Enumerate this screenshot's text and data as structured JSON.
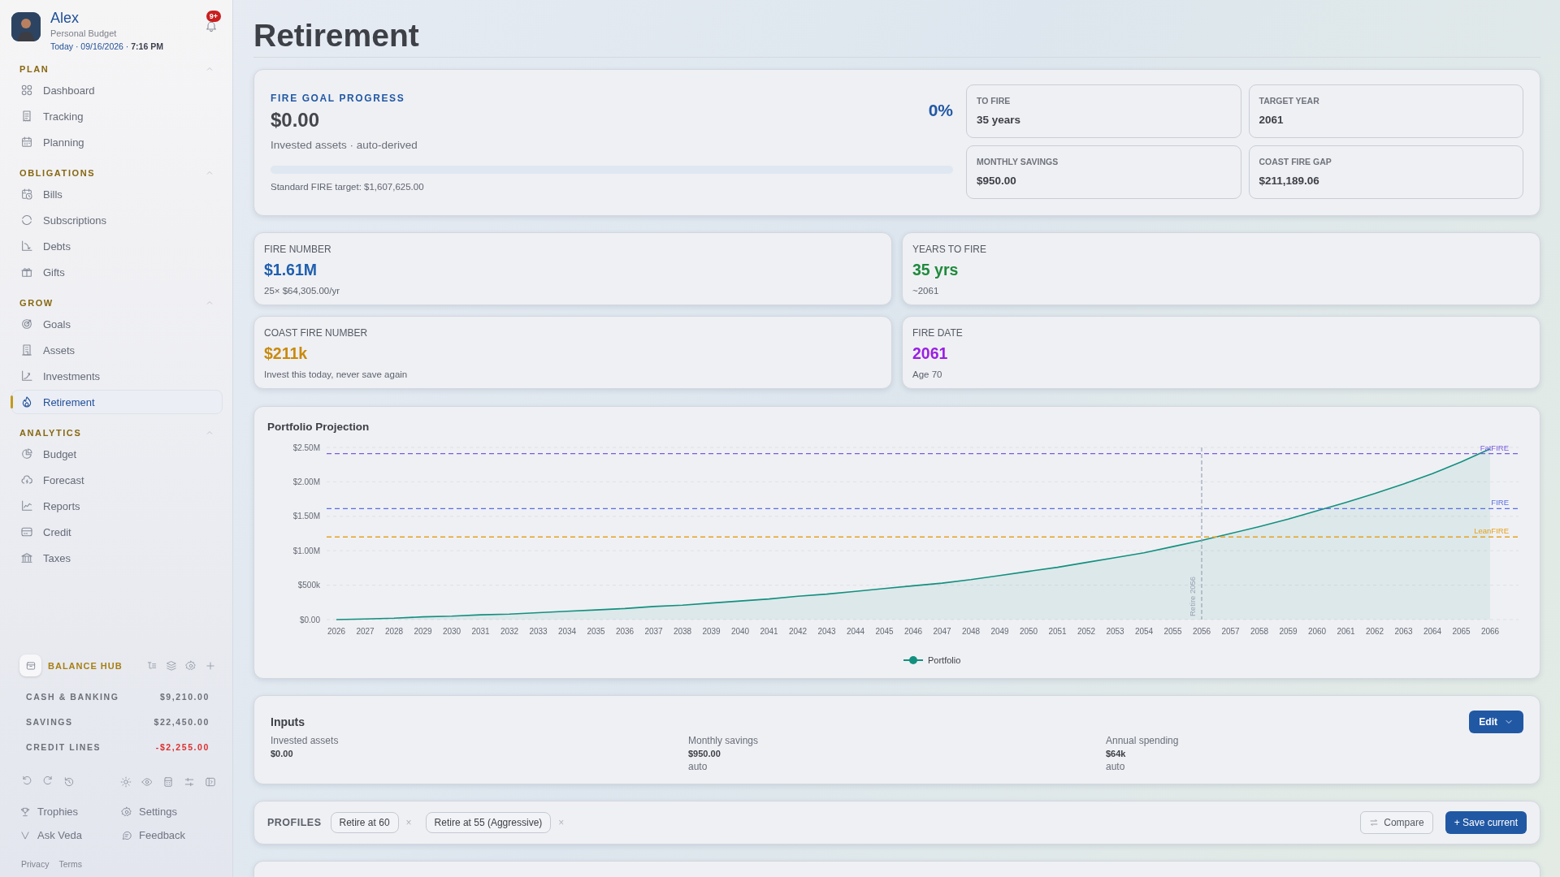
{
  "profile": {
    "name": "Alex",
    "subtitle": "Personal Budget",
    "datetime": "Today · 09/16/2026 · **7:16 PM**",
    "badge": "9+"
  },
  "sidebar": {
    "groups": [
      {
        "label": "PLAN",
        "expanded": true,
        "items": [
          {
            "label": "Dashboard",
            "selected": false
          },
          {
            "label": "Tracking",
            "selected": false
          },
          {
            "label": "Planning",
            "selected": false
          }
        ]
      },
      {
        "label": "OBLIGATIONS",
        "expanded": true,
        "items": [
          {
            "label": "Bills",
            "selected": false
          },
          {
            "label": "Subscriptions",
            "selected": false
          },
          {
            "label": "Debts",
            "selected": false
          },
          {
            "label": "Gifts",
            "selected": false
          }
        ]
      },
      {
        "label": "GROW",
        "expanded": true,
        "items": [
          {
            "label": "Goals",
            "selected": false
          },
          {
            "label": "Assets",
            "selected": false
          },
          {
            "label": "Investments",
            "selected": false
          },
          {
            "label": "Retirement",
            "selected": true
          }
        ]
      },
      {
        "label": "ANALYTICS",
        "expanded": true,
        "items": [
          {
            "label": "Budget",
            "selected": false
          },
          {
            "label": "Forecast",
            "selected": false
          },
          {
            "label": "Reports",
            "selected": false
          },
          {
            "label": "Credit",
            "selected": false
          },
          {
            "label": "Taxes",
            "selected": false
          }
        ]
      }
    ]
  },
  "balance_hub": {
    "title": "BALANCE HUB",
    "rows": [
      {
        "label": "CASH & BANKING",
        "value": "$9,210.00",
        "negative": false
      },
      {
        "label": "SAVINGS",
        "value": "$22,450.00",
        "negative": false
      },
      {
        "label": "CREDIT LINES",
        "value": "-$2,255.00",
        "negative": true
      }
    ]
  },
  "footer_links": [
    "Trophies",
    "Settings",
    "Ask Veda",
    "Feedback"
  ],
  "legal_links": [
    "Privacy",
    "Terms"
  ],
  "page_title": "Retirement",
  "goal": {
    "label": "FIRE GOAL PROGRESS",
    "amount": "$0.00",
    "caption": "Invested assets · auto-derived",
    "percent": "0%",
    "level": 0,
    "target": "Standard FIRE target: $1,607,625.00",
    "stats": [
      {
        "label": "TO FIRE",
        "value": "35 years"
      },
      {
        "label": "TARGET YEAR",
        "value": "2061"
      },
      {
        "label": "MONTHLY SAVINGS",
        "value": "$950.00"
      },
      {
        "label": "COAST FIRE GAP",
        "value": "$211,189.06"
      }
    ]
  },
  "metrics": [
    {
      "label": "FIRE NUMBER",
      "value": "$1.61M",
      "note": "25× $64,305.00/yr",
      "color": "#1f5fae"
    },
    {
      "label": "YEARS TO FIRE",
      "value": "35 yrs",
      "note": "~2061",
      "color": "#1e8a3c"
    },
    {
      "label": "COAST FIRE NUMBER",
      "value": "$211k",
      "note": "Invest this today, never save again",
      "color": "#c98a0c"
    },
    {
      "label": "FIRE DATE",
      "value": "2061",
      "note": "Age 70",
      "color": "#9a1fe3"
    }
  ],
  "projection": {
    "title": "Portfolio Projection",
    "chart_data": {
      "type": "area",
      "categories": [
        "2026",
        "2027",
        "2028",
        "2029",
        "2030",
        "2031",
        "2032",
        "2033",
        "2034",
        "2035",
        "2036",
        "2037",
        "2038",
        "2039",
        "2040",
        "2041",
        "2042",
        "2043",
        "2044",
        "2045",
        "2046",
        "2047",
        "2048",
        "2049",
        "2050",
        "2051",
        "2052",
        "2053",
        "2054",
        "2055",
        "2056",
        "2057",
        "2058",
        "2059",
        "2060",
        "2061",
        "2062",
        "2063",
        "2064",
        "2065",
        "2066"
      ],
      "series": [
        {
          "name": "Portfolio",
          "color": "#12907f",
          "values": [
            0,
            10000,
            20000,
            40000,
            50000,
            70000,
            80000,
            100000,
            120000,
            140000,
            160000,
            190000,
            210000,
            240000,
            270000,
            300000,
            340000,
            370000,
            410000,
            450000,
            490000,
            530000,
            580000,
            640000,
            700000,
            760000,
            830000,
            900000,
            970000,
            1060000,
            1150000,
            1250000,
            1350000,
            1460000,
            1580000,
            1700000,
            1830000,
            1970000,
            2120000,
            2290000,
            2480000
          ]
        }
      ],
      "ylim": [
        0,
        2500000
      ],
      "yticks": [
        {
          "value": 0,
          "label": "$0.00"
        },
        {
          "value": 500000,
          "label": "$500k"
        },
        {
          "value": 1000000,
          "label": "$1.00M"
        },
        {
          "value": 1500000,
          "label": "$1.50M"
        },
        {
          "value": 2000000,
          "label": "$2.00M"
        },
        {
          "value": 2500000,
          "label": "$2.50M"
        }
      ],
      "grid": true,
      "ref_lines": [
        {
          "axis": "y",
          "value": 2410000,
          "label": "FatFIRE",
          "color": "#7a5ce0"
        },
        {
          "axis": "y",
          "value": 1610000,
          "label": "FIRE",
          "color": "#5a6ee0"
        },
        {
          "axis": "y",
          "value": 1200000,
          "label": "LeanFIRE",
          "color": "#e6a21c"
        },
        {
          "axis": "x",
          "value": "2056",
          "label": "Retire 2056",
          "color": "#9aa3b5"
        }
      ]
    }
  },
  "inputs": {
    "title": "Inputs",
    "edit_button": "Edit",
    "fields": [
      {
        "label": "Invested assets",
        "value": "$0.00"
      },
      {
        "label": "Monthly savings",
        "value": "$950.00",
        "note": "auto"
      },
      {
        "label": "Annual spending",
        "value": "$64k",
        "note": "auto"
      }
    ]
  },
  "profiles": {
    "label": "PROFILES",
    "chips": [
      "Retire at 60",
      "Retire at 55 (Aggressive)"
    ],
    "remove": "×",
    "compare_button": "Compare",
    "save_button": "+ Save current"
  }
}
